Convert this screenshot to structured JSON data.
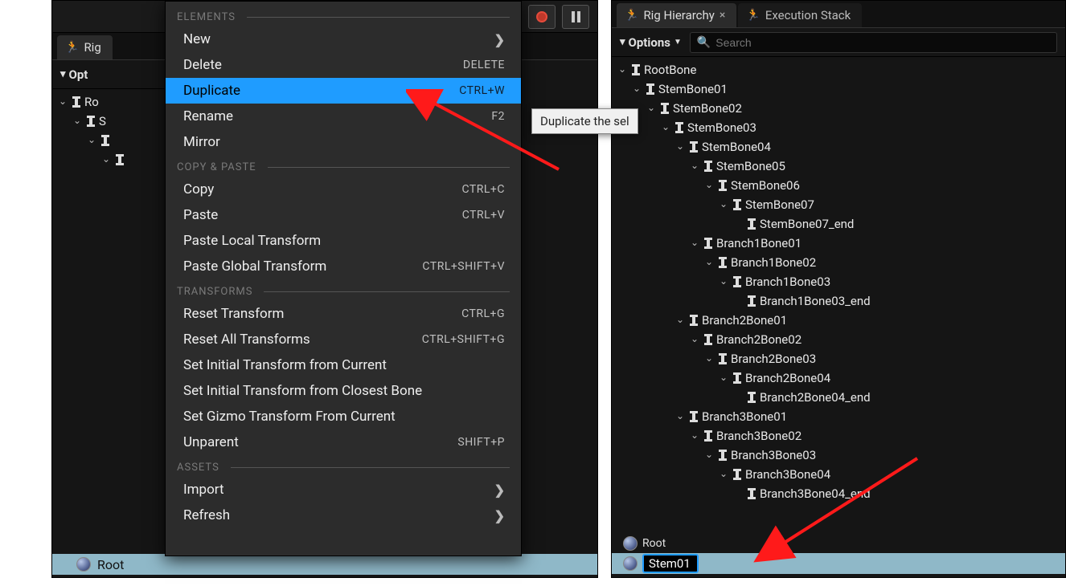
{
  "left": {
    "tab_label": "Rig",
    "options_label": "Opt",
    "tree_partial": [
      "Ro",
      "S"
    ],
    "root_label": "Root"
  },
  "ctx": {
    "sections": {
      "elements": "ELEMENTS",
      "copypaste": "COPY & PASTE",
      "transforms": "TRANSFORMS",
      "assets": "ASSETS"
    },
    "items": {
      "new": "New",
      "delete": "Delete",
      "delete_sc": "DELETE",
      "duplicate": "Duplicate",
      "duplicate_sc": "CTRL+W",
      "rename": "Rename",
      "rename_sc": "F2",
      "mirror": "Mirror",
      "copy": "Copy",
      "copy_sc": "CTRL+C",
      "paste": "Paste",
      "paste_sc": "CTRL+V",
      "paste_local": "Paste Local Transform",
      "paste_global": "Paste Global Transform",
      "paste_global_sc": "CTRL+SHIFT+V",
      "reset_t": "Reset Transform",
      "reset_t_sc": "CTRL+G",
      "reset_all": "Reset All Transforms",
      "reset_all_sc": "CTRL+SHIFT+G",
      "set_init_cur": "Set Initial Transform from Current",
      "set_init_bone": "Set Initial Transform from Closest Bone",
      "set_gizmo": "Set Gizmo Transform From Current",
      "unparent": "Unparent",
      "unparent_sc": "SHIFT+P",
      "import": "Import",
      "refresh": "Refresh"
    }
  },
  "tooltip": "Duplicate the sel",
  "right": {
    "tab_active": "Rig Hierarchy",
    "tab_inactive": "Execution Stack",
    "options_label": "Options",
    "search_placeholder": "Search",
    "bones": [
      {
        "indent": 0,
        "exp": true,
        "name": "RootBone"
      },
      {
        "indent": 1,
        "exp": true,
        "name": "StemBone01"
      },
      {
        "indent": 2,
        "exp": true,
        "name": "StemBone02"
      },
      {
        "indent": 3,
        "exp": true,
        "name": "StemBone03"
      },
      {
        "indent": 4,
        "exp": true,
        "name": "StemBone04"
      },
      {
        "indent": 5,
        "exp": true,
        "name": "StemBone05"
      },
      {
        "indent": 6,
        "exp": true,
        "name": "StemBone06"
      },
      {
        "indent": 7,
        "exp": true,
        "name": "StemBone07"
      },
      {
        "indent": 8,
        "exp": false,
        "name": "StemBone07_end"
      },
      {
        "indent": 5,
        "exp": true,
        "name": "Branch1Bone01"
      },
      {
        "indent": 6,
        "exp": true,
        "name": "Branch1Bone02"
      },
      {
        "indent": 7,
        "exp": true,
        "name": "Branch1Bone03"
      },
      {
        "indent": 8,
        "exp": false,
        "name": "Branch1Bone03_end"
      },
      {
        "indent": 4,
        "exp": true,
        "name": "Branch2Bone01"
      },
      {
        "indent": 5,
        "exp": true,
        "name": "Branch2Bone02"
      },
      {
        "indent": 6,
        "exp": true,
        "name": "Branch2Bone03"
      },
      {
        "indent": 7,
        "exp": true,
        "name": "Branch2Bone04"
      },
      {
        "indent": 8,
        "exp": false,
        "name": "Branch2Bone04_end"
      },
      {
        "indent": 4,
        "exp": true,
        "name": "Branch3Bone01"
      },
      {
        "indent": 5,
        "exp": true,
        "name": "Branch3Bone02"
      },
      {
        "indent": 6,
        "exp": true,
        "name": "Branch3Bone03"
      },
      {
        "indent": 7,
        "exp": true,
        "name": "Branch3Bone04"
      },
      {
        "indent": 8,
        "exp": false,
        "name": "Branch3Bone04_end"
      }
    ],
    "root_label": "Root",
    "rename_value": "Stem01"
  }
}
